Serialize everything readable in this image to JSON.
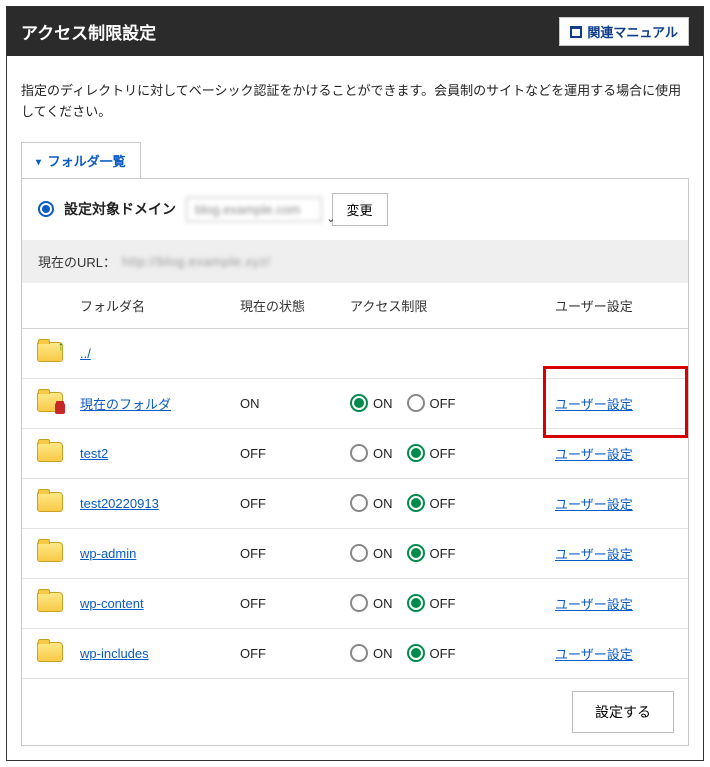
{
  "header": {
    "title": "アクセス制限設定",
    "manual_button": "関連マニュアル"
  },
  "description": "指定のディレクトリに対してベーシック認証をかけることができます。会員制のサイトなどを運用する場合に使用してください。",
  "tab": {
    "label": "フォルダ一覧"
  },
  "domain": {
    "label": "設定対象ドメイン",
    "selected_display": "blog.example.com",
    "change_button": "変更"
  },
  "url_bar": {
    "prefix": "現在のURL：",
    "value": "http://blog.example.xyz/"
  },
  "columns": {
    "icon": "",
    "name": "フォルダ名",
    "state": "現在の状態",
    "access": "アクセス制限",
    "user": "ユーザー設定"
  },
  "access_labels": {
    "on": "ON",
    "off": "OFF"
  },
  "rows": [
    {
      "icon": "folder-up",
      "name": "../",
      "state": "",
      "access": "",
      "user_link": ""
    },
    {
      "icon": "folder-lock",
      "name": "現在のフォルダ",
      "state": "ON",
      "access": "on",
      "user_link": "ユーザー設定",
      "highlight": true
    },
    {
      "icon": "folder",
      "name": "test2",
      "state": "OFF",
      "access": "off",
      "user_link": "ユーザー設定"
    },
    {
      "icon": "folder",
      "name": "test20220913",
      "state": "OFF",
      "access": "off",
      "user_link": "ユーザー設定"
    },
    {
      "icon": "folder",
      "name": "wp-admin",
      "state": "OFF",
      "access": "off",
      "user_link": "ユーザー設定"
    },
    {
      "icon": "folder",
      "name": "wp-content",
      "state": "OFF",
      "access": "off",
      "user_link": "ユーザー設定"
    },
    {
      "icon": "folder",
      "name": "wp-includes",
      "state": "OFF",
      "access": "off",
      "user_link": "ユーザー設定"
    }
  ],
  "apply_button": "設定する"
}
